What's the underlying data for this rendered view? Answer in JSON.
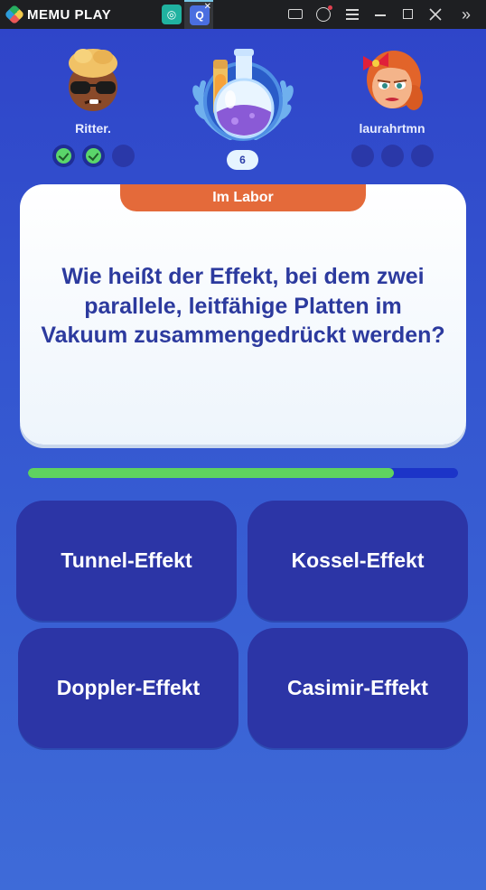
{
  "titlebar": {
    "app_name": "MEMU PLAY",
    "tabs": [
      {
        "icon": "app-tab-icon",
        "glyph": "◎"
      },
      {
        "icon": "quiz-app-tab-icon",
        "glyph": "Q",
        "close": "✕"
      }
    ],
    "controls": {
      "more": "»"
    }
  },
  "players": {
    "left": {
      "name": "Ritter.",
      "results": [
        "correct",
        "correct",
        "pending"
      ]
    },
    "right": {
      "name": "laurahrtmn",
      "results": [
        "pending",
        "pending",
        "pending"
      ]
    }
  },
  "round": "6",
  "question": {
    "category": "Im Labor",
    "text": "Wie heißt der Effekt, bei dem zwei parallele, leitfähige Platten im Vakuum zusammengedrückt werden?"
  },
  "timer": {
    "remaining_fraction": 0.85
  },
  "answers": [
    "Tunnel-Effekt",
    "Kossel-Effekt",
    "Doppler-Effekt",
    "Casimir-Effekt"
  ],
  "colors": {
    "background": "#3456d0",
    "card": "#ffffff",
    "category": "#e46a3a",
    "answer_button": "#2c35a6",
    "timer_fill": "#5fd35f",
    "question_text": "#2c3a9e"
  }
}
